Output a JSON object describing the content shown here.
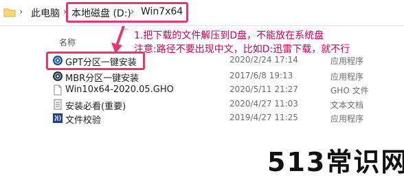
{
  "address_bar": {
    "crumbs": [
      "此电脑",
      "本地磁盘 (D:)",
      "Win7x64"
    ],
    "separator": "›"
  },
  "columns": {
    "name": "名称"
  },
  "files": [
    {
      "name": "GPT分区一键安装",
      "date": "2020/2/24 17:14",
      "type": "应用程序",
      "icon": "gpt-app-icon"
    },
    {
      "name": "MBR分区一键安装",
      "date": "2017/6/8 19:13",
      "type": "应用程序",
      "icon": "mbr-app-icon"
    },
    {
      "name": "Win10x64-2020.05.GHO",
      "date": "2020/5/11 21:27",
      "type": "GHO 文件",
      "icon": "file-icon"
    },
    {
      "name": "安装必看(重要)",
      "date": "2020/4/27 11:03",
      "type": "文本文档",
      "icon": "text-file-icon"
    },
    {
      "name": "文件校验",
      "date": "2019/4/27 11:25",
      "type": "应用程序",
      "icon": "checksum-app-icon"
    }
  ],
  "annotation": {
    "line1": "1.把下载的文件解压到D盘，不能放在系统盘",
    "line2": "注意:路径不要出现中文，比如D:迅雷下载，就不行",
    "color": "#c8005a"
  },
  "highlight_color": "#e8356f",
  "watermark": "513常识网"
}
